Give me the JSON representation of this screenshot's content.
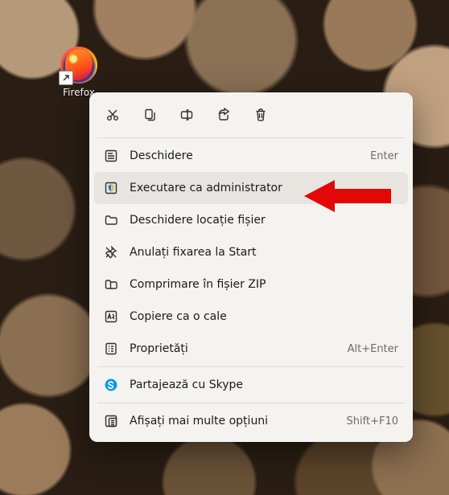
{
  "desktop": {
    "icon": {
      "label": "Firefox"
    }
  },
  "toolbar": {
    "cut": "Cut",
    "copy": "Copy",
    "rename": "Rename",
    "share": "Share",
    "delete": "Delete"
  },
  "menu": {
    "open": {
      "label": "Deschidere",
      "shortcut": "Enter"
    },
    "run_admin": {
      "label": "Executare ca administrator"
    },
    "open_loc": {
      "label": "Deschidere locație fișier"
    },
    "unpin": {
      "label": "Anulați fixarea la Start"
    },
    "compress": {
      "label": "Comprimare în fișier ZIP"
    },
    "copy_path": {
      "label": "Copiere ca o cale"
    },
    "properties": {
      "label": "Proprietăți",
      "shortcut": "Alt+Enter"
    },
    "skype": {
      "label": "Partajează cu Skype"
    },
    "more": {
      "label": "Afișați mai multe opțiuni",
      "shortcut": "Shift+F10"
    }
  }
}
